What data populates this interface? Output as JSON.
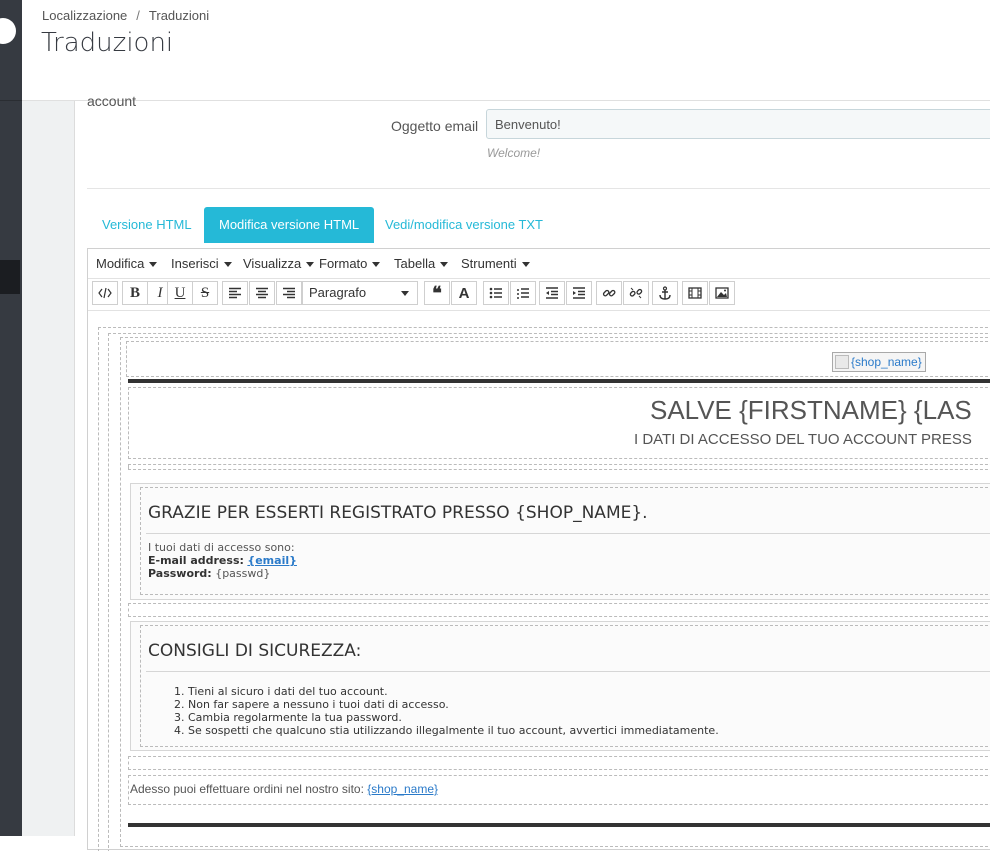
{
  "breadcrumb": {
    "item1": "Localizzazione",
    "separator": "/",
    "item2": "Traduzioni"
  },
  "page": {
    "title": "Traduzioni"
  },
  "form": {
    "cut_label": "account",
    "subject_label": "Oggetto email",
    "subject_value": "Benvenuto!",
    "subject_hint": "Welcome!"
  },
  "tabs": [
    {
      "label": "Versione HTML",
      "active": false
    },
    {
      "label": "Modifica versione HTML",
      "active": true
    },
    {
      "label": "Vedi/modifica versione TXT",
      "active": false
    }
  ],
  "editor": {
    "menu": [
      "Modifica",
      "Inserisci",
      "Visualizza",
      "Formato",
      "Tabella",
      "Strumenti"
    ],
    "format_select": "Paragrafo",
    "toolbar_icons": [
      "source-code-icon",
      "bold-icon",
      "italic-icon",
      "underline-icon",
      "strikethrough-icon",
      "align-left-icon",
      "align-center-icon",
      "align-right-icon",
      "blockquote-icon",
      "text-color-icon",
      "bullet-list-icon",
      "numbered-list-icon",
      "outdent-icon",
      "indent-icon",
      "link-icon",
      "unlink-icon",
      "anchor-icon",
      "media-icon",
      "image-icon"
    ]
  },
  "email": {
    "logo_alt": "{shop_name}",
    "hello": "SALVE {FIRSTNAME} {LAS",
    "hello_sub": "I DATI DI ACCESSO DEL TUO ACCOUNT PRESS",
    "thanks_title": "GRAZIE PER ESSERTI REGISTRATO PRESSO {SHOP_NAME}.",
    "access_intro": "I tuoi dati di accesso sono:",
    "email_label": "E-mail address:",
    "email_value": "{email}",
    "password_label": "Password:",
    "password_value": "{passwd}",
    "security_title": "CONSIGLI DI SICUREZZA:",
    "tips": [
      "1. Tieni al sicuro i dati del tuo account.",
      "2. Non far sapere a nessuno i tuoi dati di accesso.",
      "3. Cambia regolarmente la tua password.",
      "4. Se sospetti che qualcuno stia utilizzando illegalmente il tuo account, avvertici immediatamente."
    ],
    "order_text": "Adesso puoi effettuare ordini nel nostro sito:",
    "order_link": "{shop_name}"
  },
  "colors": {
    "accent": "#25b9d7",
    "sidebar": "#363a41",
    "link": "#2a7ac9"
  }
}
